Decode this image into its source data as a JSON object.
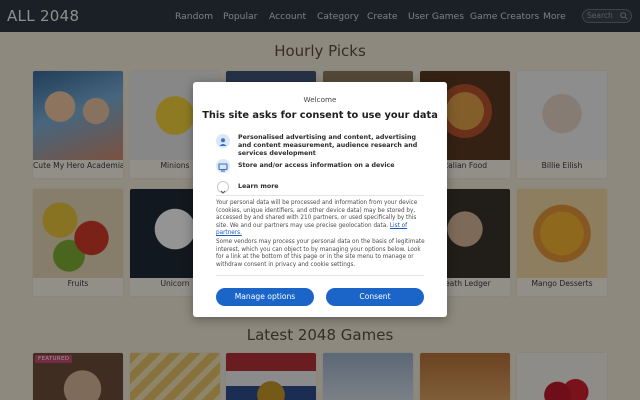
{
  "header": {
    "logo": "ALL 2048",
    "nav": [
      "Random",
      "Popular",
      "Account",
      "Category",
      "Create",
      "User Games",
      "Game Creators",
      "More"
    ],
    "search_placeholder": "Search"
  },
  "sections": {
    "hourly": "Hourly Picks",
    "latest": "Latest 2048 Games"
  },
  "hourly_cards": [
    "Cute My Hero Academia",
    "Minions",
    "",
    "",
    "Italian Food",
    "Billie Eilish",
    "Fruits",
    "Unicorn",
    "",
    "",
    "Heath Ledger",
    "Mango Desserts"
  ],
  "latest_badge": "FEATURED",
  "consent": {
    "welcome": "Welcome",
    "title": "This site asks for consent to use your data",
    "purposes": [
      "Personalised advertising and content, advertising and content measurement, audience research and services development",
      "Store and/or access information on a device"
    ],
    "learn_more": "Learn more",
    "paragraph1": "Your personal data will be processed and information from your device (cookies, unique identifiers, and other device data) may be stored by, accessed by and shared with 210 partners, or used specifically by this site. We and our partners may use precise geolocation data.",
    "partners_link": "List of partners.",
    "paragraph2": "Some vendors may process your personal data on the basis of legitimate interest, which you can object to by managing your options below. Look for a link at the bottom of this page or in the site menu to manage or withdraw consent in privacy and cookie settings.",
    "manage_label": "Manage options",
    "consent_label": "Consent"
  },
  "colors": {
    "accent": "#1a65c7",
    "topbar": "#2f3844",
    "page_bg": "#f3ecd9"
  }
}
